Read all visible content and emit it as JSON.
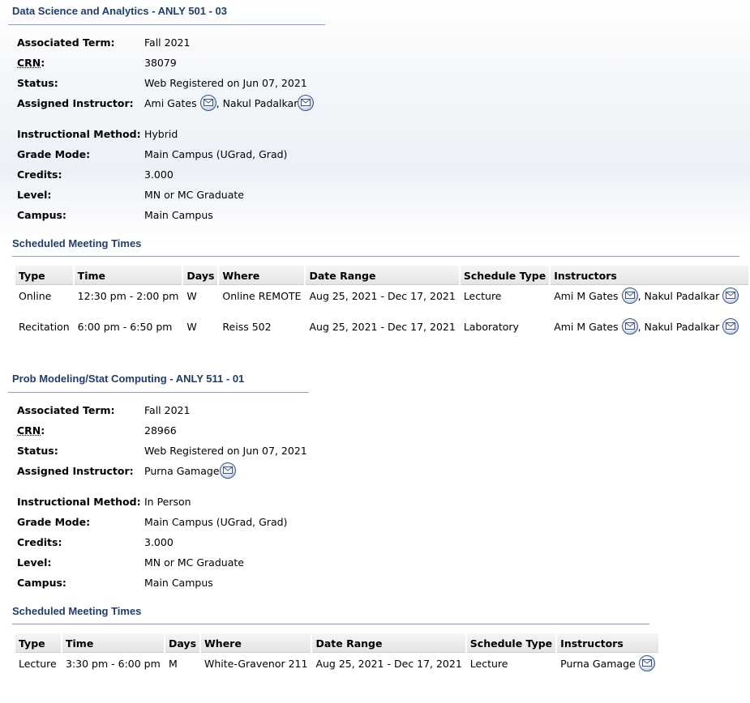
{
  "labels": {
    "associated_term": "Associated Term:",
    "crn": "CRN",
    "crn_colon": ":",
    "status": "Status:",
    "assigned_instructor": "Assigned Instructor:",
    "instructional_method": "Instructional Method:",
    "grade_mode": "Grade Mode:",
    "credits": "Credits:",
    "level": "Level:",
    "campus": "Campus:",
    "scheduled_meeting_times": "Scheduled Meeting Times",
    "separator": ","
  },
  "table_headers": [
    "Type",
    "Time",
    "Days",
    "Where",
    "Date Range",
    "Schedule Type",
    "Instructors"
  ],
  "courses": [
    {
      "title": "Data Science and Analytics - ANLY 501 - 03",
      "associated_term": "Fall 2021",
      "crn": "38079",
      "status": "Web Registered on Jun 07, 2021",
      "instructors": [
        "Ami Gates",
        "Nakul Padalkar"
      ],
      "instructional_method": "Hybrid",
      "grade_mode": "Main Campus (UGrad, Grad)",
      "credits": "3.000",
      "level": "MN or MC Graduate",
      "campus": "Main Campus",
      "meetings": [
        {
          "type": "Online",
          "time": "12:30 pm - 2:00 pm",
          "days": "W",
          "where": "Online REMOTE",
          "date_range": "Aug 25, 2021 - Dec 17, 2021",
          "schedule_type": "Lecture",
          "instructors": [
            "Ami M Gates",
            "Nakul Padalkar"
          ]
        },
        {
          "type": "Recitation",
          "time": "6:00 pm - 6:50 pm",
          "days": "W",
          "where": "Reiss 502",
          "date_range": "Aug 25, 2021 - Dec 17, 2021",
          "schedule_type": "Laboratory",
          "instructors": [
            "Ami M Gates",
            "Nakul Padalkar"
          ]
        }
      ]
    },
    {
      "title": "Prob Modeling/Stat Computing - ANLY 511 - 01",
      "associated_term": "Fall 2021",
      "crn": "28966",
      "status": "Web Registered on Jun 07, 2021",
      "instructors": [
        "Purna Gamage"
      ],
      "instructional_method": "In Person",
      "grade_mode": "Main Campus (UGrad, Grad)",
      "credits": "3.000",
      "level": "MN or MC Graduate",
      "campus": "Main Campus",
      "meetings": [
        {
          "type": "Lecture",
          "time": "3:30 pm - 6:00 pm",
          "days": "M",
          "where": "White-Gravenor 211",
          "date_range": "Aug 25, 2021 - Dec 17, 2021",
          "schedule_type": "Lecture",
          "instructors": [
            "Purna Gamage"
          ]
        }
      ]
    }
  ],
  "colors": {
    "title": "#1f3d6e",
    "rule": "#8aa1bf",
    "header_bg": "#e4e4e4"
  },
  "icons": {
    "email": "envelope-icon"
  }
}
